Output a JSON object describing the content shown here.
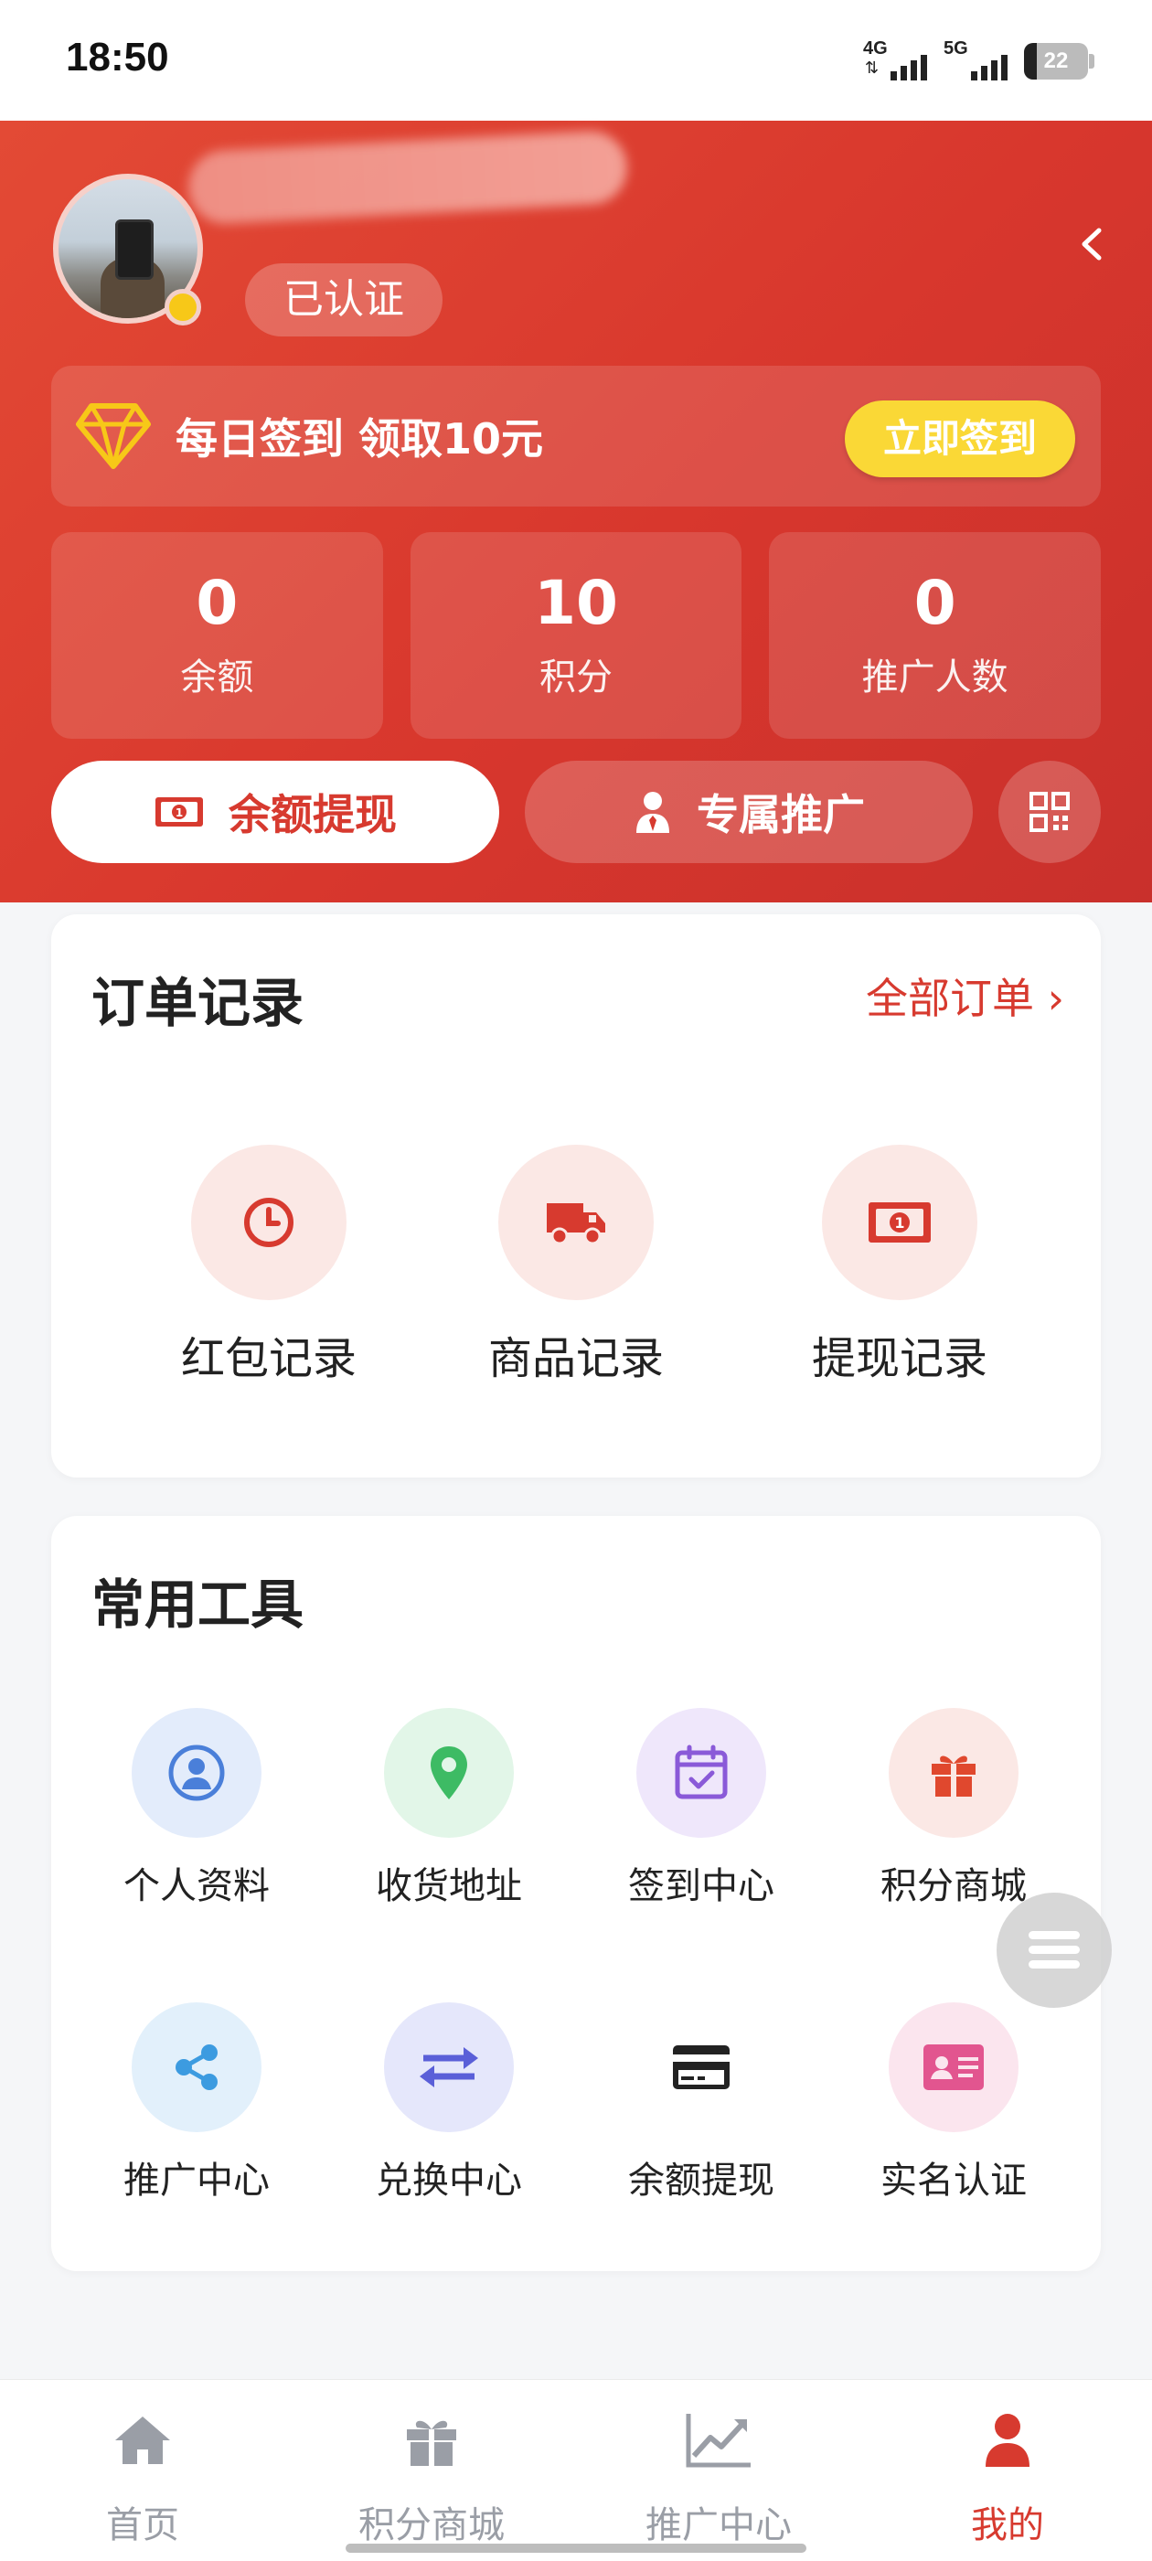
{
  "status_bar": {
    "time": "18:50",
    "net1": "4G",
    "net2": "5G",
    "battery": "22"
  },
  "profile": {
    "verified_label": "已认证"
  },
  "checkin": {
    "text": "每日签到 领取10元",
    "button": "立即签到"
  },
  "stats": [
    {
      "value": "0",
      "label": "余额"
    },
    {
      "value": "10",
      "label": "积分"
    },
    {
      "value": "0",
      "label": "推广人数"
    }
  ],
  "actions": {
    "withdraw": "余额提现",
    "promotion": "专属推广"
  },
  "orders": {
    "title": "订单记录",
    "link": "全部订单 ›",
    "items": [
      {
        "label": "红包记录",
        "icon": "clock-icon"
      },
      {
        "label": "商品记录",
        "icon": "truck-icon"
      },
      {
        "label": "提现记录",
        "icon": "money-icon"
      }
    ]
  },
  "tools": {
    "title": "常用工具",
    "items": [
      {
        "label": "个人资料",
        "icon": "user-icon",
        "color": "#4a7fd9",
        "bg": "#e3ecfb"
      },
      {
        "label": "收货地址",
        "icon": "location-pin-icon",
        "color": "#3dbb64",
        "bg": "#e2f6e8"
      },
      {
        "label": "签到中心",
        "icon": "calendar-check-icon",
        "color": "#8a5ad8",
        "bg": "#efe7fb"
      },
      {
        "label": "积分商城",
        "icon": "gift-icon",
        "color": "#e0482e",
        "bg": "#fbe8e5"
      },
      {
        "label": "推广中心",
        "icon": "share-icon",
        "color": "#3c9be0",
        "bg": "#e2f0fb"
      },
      {
        "label": "兑换中心",
        "icon": "exchange-icon",
        "color": "#5a5fd8",
        "bg": "#e5e7fb"
      },
      {
        "label": "余额提现",
        "icon": "credit-card-icon",
        "color": "#222222",
        "bg": "#ffffff"
      },
      {
        "label": "实名认证",
        "icon": "id-card-icon",
        "color": "#e2558f",
        "bg": "#fbe5ee"
      }
    ]
  },
  "tabbar": [
    {
      "label": "首页",
      "icon": "home-icon"
    },
    {
      "label": "积分商城",
      "icon": "gift-icon"
    },
    {
      "label": "推广中心",
      "icon": "chart-icon"
    },
    {
      "label": "我的",
      "icon": "person-icon",
      "active": true
    }
  ],
  "colors": {
    "primary": "#d73a2f",
    "accent_yellow": "#fad836",
    "text": "#222222",
    "tab_inactive": "#9a9ea6"
  }
}
